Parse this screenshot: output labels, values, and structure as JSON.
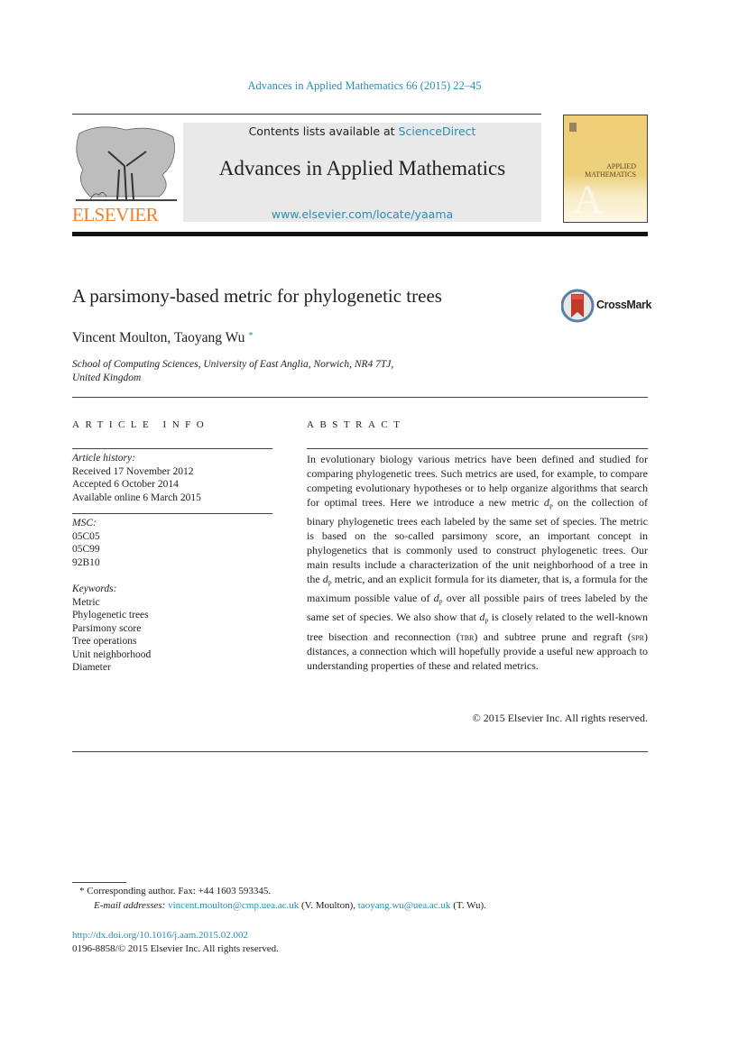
{
  "header": {
    "journal_ref": "Advances in Applied Mathematics 66 (2015) 22–45",
    "contents_prefix": "Contents lists available at ",
    "contents_link": "ScienceDirect",
    "journal_title": "Advances in Applied Mathematics",
    "journal_url": "www.elsevier.com/locate/yaama",
    "publisher_logo_text": "ELSEVIER",
    "cover_title_line1": "APPLIED",
    "cover_title_line2": "MATHEMATICS",
    "cover_letter": "A"
  },
  "colors": {
    "link": "#2a8db5",
    "elsevier_orange": "#f47f24",
    "cover_gold": "#eecf78",
    "crossmark_red": "#c0392b",
    "crossmark_ring": "#5b7fa6"
  },
  "article": {
    "title": "A parsimony-based metric for phylogenetic trees",
    "crossmark_label": "CrossMark",
    "authors": "Vincent Moulton, Taoyang Wu",
    "author_marker": "*",
    "affiliation_line1": "School of Computing Sciences, University of East Anglia, Norwich, NR4 7TJ,",
    "affiliation_line2": "United Kingdom"
  },
  "article_info": {
    "heading": "ARTICLE INFO",
    "history_label": "Article history:",
    "history": [
      "Received 17 November 2012",
      "Accepted 6 October 2014",
      "Available online 6 March 2015"
    ],
    "msc_label": "MSC:",
    "msc": [
      "05C05",
      "05C99",
      "92B10"
    ],
    "keywords_label": "Keywords:",
    "keywords": [
      "Metric",
      "Phylogenetic trees",
      "Parsimony score",
      "Tree operations",
      "Unit neighborhood",
      "Diameter"
    ]
  },
  "abstract": {
    "heading": "ABSTRACT",
    "p1": "In evolutionary biology various metrics have been defined and studied for comparing phylogenetic trees. Such metrics are used, for example, to compare competing evolutionary hypotheses or to help organize algorithms that search for optimal trees. Here we introduce a new metric ",
    "p2": " on the collection of binary phylogenetic trees each labeled by the same set of species. The metric is based on the so-called parsimony score, an important concept in phylogenetics that is commonly used to construct phylogenetic trees. Our main results include a characterization of the unit neighborhood of a tree in the ",
    "p3": " metric, and an explicit formula for its diameter, that is, a formula for the maximum possible value of ",
    "p4": " over all possible pairs of trees labeled by the same set of species. We also show that ",
    "p5": " is closely related to the well-known tree bisection and reconnection (",
    "tbr": "tbr",
    "p6": ") and subtree prune and regraft (",
    "spr": "spr",
    "p7": ") distances, a connection which will hopefully provide a useful new approach to understanding properties of these and related metrics.",
    "symbol": "d",
    "symbol_sub": "P",
    "copyright": "© 2015 Elsevier Inc. All rights reserved."
  },
  "footnotes": {
    "marker": "*",
    "corresponding": "Corresponding author. Fax: +44 1603 593345.",
    "email_label": "E-mail addresses:",
    "email1": "vincent.moulton@cmp.uea.ac.uk",
    "email1_name": " (V. Moulton), ",
    "email2": "taoyang.wu@uea.ac.uk",
    "email2_name": " (T. Wu).",
    "doi": "http://dx.doi.org/10.1016/j.aam.2015.02.002",
    "issn": "0196-8858/© 2015 Elsevier Inc. All rights reserved."
  }
}
